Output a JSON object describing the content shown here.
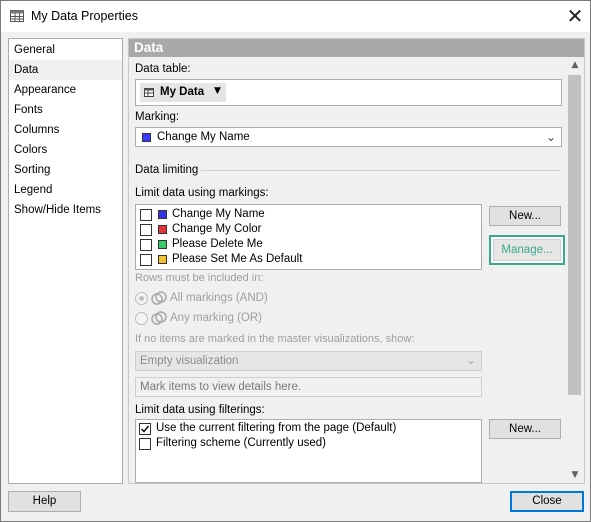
{
  "window": {
    "title": "My Data Properties",
    "app_icon": "table-icon",
    "close_icon": "close-icon"
  },
  "nav": {
    "items": [
      "General",
      "Data",
      "Appearance",
      "Fonts",
      "Columns",
      "Colors",
      "Sorting",
      "Legend",
      "Show/Hide Items"
    ],
    "selected": "Data"
  },
  "panel": {
    "title": "Data",
    "data_table": {
      "label": "Data table:",
      "value": "My Data"
    },
    "marking": {
      "label": "Marking:",
      "value": "Change My Name",
      "color": "#3a3aff"
    },
    "data_limiting": {
      "heading": "Data limiting",
      "markings_label": "Limit data using markings:",
      "markings": [
        {
          "name": "Change My Name",
          "color": "#3333e6",
          "checked": false
        },
        {
          "name": "Change My Color",
          "color": "#e63333",
          "checked": false
        },
        {
          "name": "Please Delete Me",
          "color": "#33cc66",
          "checked": false
        },
        {
          "name": "Please Set Me As Default",
          "color": "#f2c233",
          "checked": false
        }
      ],
      "new_button": "New...",
      "manage_button": "Manage...",
      "manage_highlight": "#3aa88a",
      "rows_label": "Rows must be included in:",
      "all_markings": "All markings (AND)",
      "any_marking": "Any marking (OR)",
      "empty_label": "If no items are marked in the master visualizations, show:",
      "empty_value": "Empty visualization",
      "message_placeholder": "Mark items to view details here.",
      "filterings_label": "Limit data using filterings:",
      "filterings": [
        {
          "name": "Use the current filtering from the page (Default)",
          "checked": true
        },
        {
          "name": "Filtering scheme (Currently used)",
          "checked": false
        }
      ],
      "new_filter_button": "New..."
    }
  },
  "footer": {
    "help_button": "Help",
    "close_button": "Close"
  }
}
